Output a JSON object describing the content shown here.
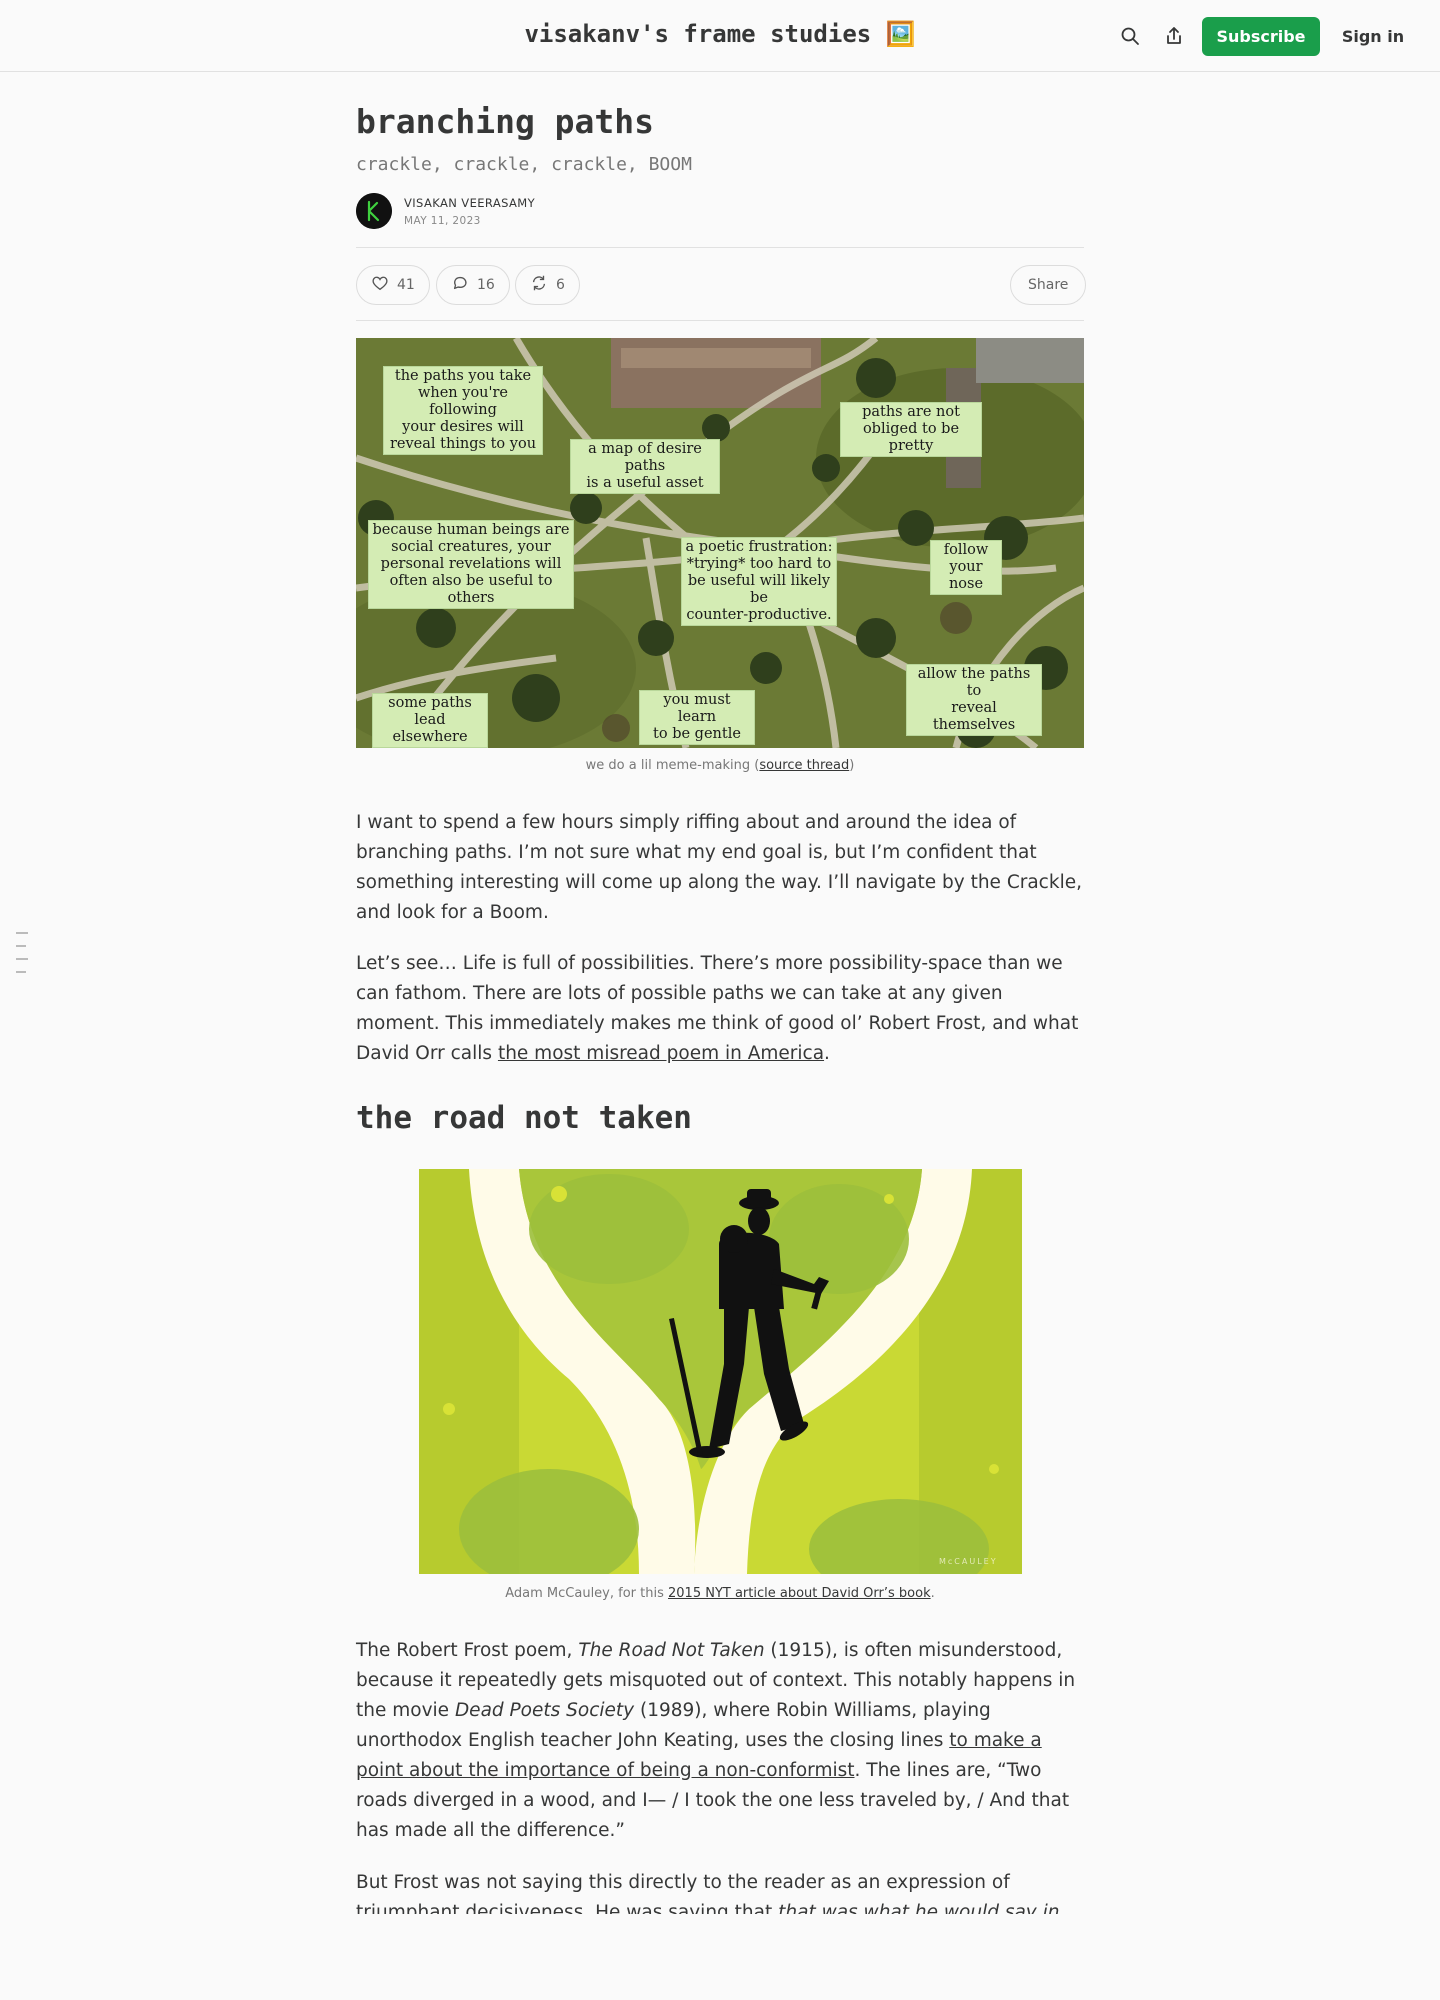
{
  "header": {
    "site_title": "visakanv's frame studies 🖼️",
    "subscribe_label": "Subscribe",
    "signin_label": "Sign in",
    "search_icon": "search-icon",
    "share_icon": "share-icon"
  },
  "post": {
    "title": "branching paths",
    "subtitle": "crackle, crackle, crackle, BOOM",
    "author": "VISAKAN VEERASAMY",
    "date": "MAY 11, 2023",
    "likes": "41",
    "comments": "16",
    "restacks": "6",
    "share_label": "Share"
  },
  "hero": {
    "labels": [
      "the paths you take\nwhen you're following\nyour desires will\nreveal things to you",
      "a map of desire paths\nis a useful asset",
      "paths are not\nobliged to be pretty",
      "because human beings are\nsocial creatures, your\npersonal revelations will\noften also be useful to others",
      "a poetic frustration:\n*trying* too hard to\nbe useful will likely be\ncounter-productive.",
      "follow\nyour nose",
      "allow the paths to\nreveal themselves",
      "some paths lead\nelsewhere",
      "you must learn\nto be gentle"
    ],
    "caption_prefix": "we do a lil meme-making (",
    "caption_link": "source thread",
    "caption_suffix": ")"
  },
  "paragraphs": {
    "p1": "I want to spend a few hours simply riffing about and around the idea of branching paths. I’m not sure what my end goal is, but I’m confident that something interesting will come up along the way. I’ll navigate by the Crackle, and look for a Boom.",
    "p2_before": "Let’s see… Life is full of possibilities. There’s more possibility-space than we can fathom. There are lots of possible paths we can take at any given moment. This immediately makes me think of good ol’ Robert Frost, and what David Orr calls ",
    "p2_link": "the most misread poem in America",
    "p2_after": ".",
    "h2": "the road not taken",
    "road_caption_prefix": "Adam McCauley, for this ",
    "road_caption_link": "2015 NYT article about David Orr’s book",
    "road_caption_suffix": ".",
    "road_signature": "McCAULEY",
    "p3_a": "The Robert Frost poem, ",
    "p3_b": "The Road Not Taken",
    "p3_c": " (1915), is often misunderstood, because it repeatedly gets misquoted out of context. This notably happens in the movie ",
    "p3_d": "Dead Poets Society",
    "p3_e": " (1989), where Robin Williams, playing unorthodox English teacher John Keating, uses the closing lines ",
    "p3_link": "to make a point about the importance of being a non-conformist",
    "p3_f": ". The lines are, “Two roads diverged in a wood, and I— / I took the one less traveled by, / And that has made all the difference.”",
    "p4_a": "But Frost was not saying this directly to the reader as an expression of triumphant decisiveness. He was saying that ",
    "p4_b": "that was what he would say in"
  },
  "colors": {
    "accent": "#1a9e4b",
    "label_bg": "#d4ecb4",
    "road_green": "#c9d934",
    "road_path": "#fffbe8"
  }
}
